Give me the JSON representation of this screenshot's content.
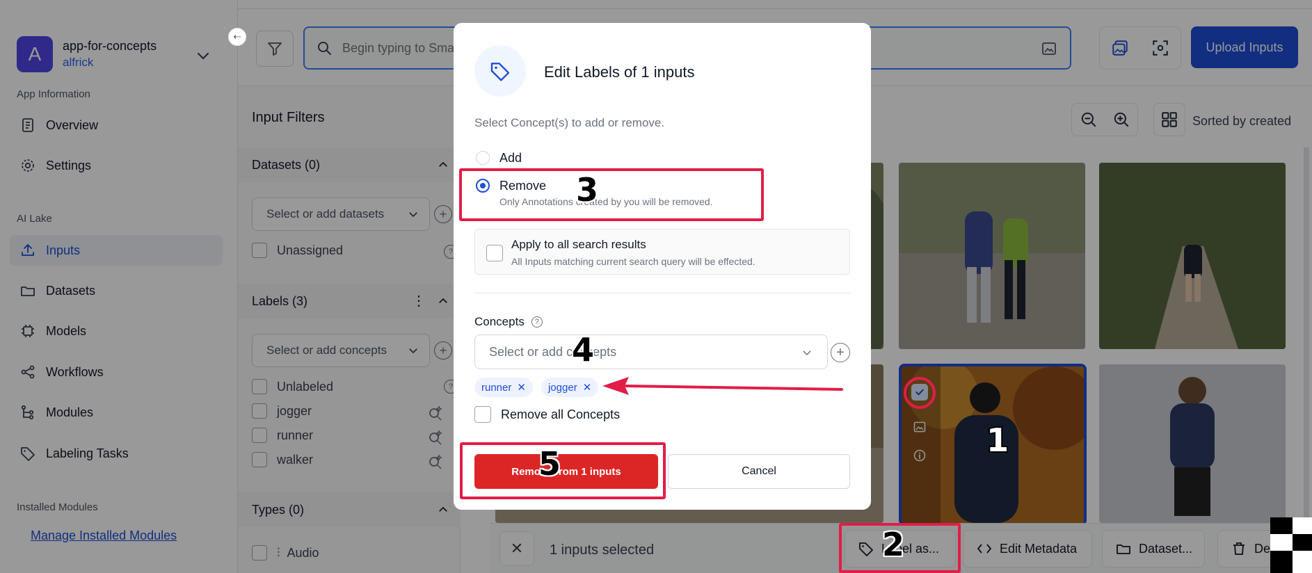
{
  "app": {
    "avatar_letter": "A",
    "name": "app-for-concepts",
    "user": "alfrick",
    "brand_color": "#4f46e5",
    "accent_color": "#1d4ed8",
    "danger_color": "#dc2626",
    "annotation_color": "#e11d48"
  },
  "sidebar": {
    "section_app_info": "App Information",
    "overview": "Overview",
    "settings": "Settings",
    "section_ai_lake": "AI Lake",
    "inputs": "Inputs",
    "datasets": "Datasets",
    "models": "Models",
    "workflows": "Workflows",
    "modules": "Modules",
    "labeling_tasks": "Labeling Tasks",
    "section_installed": "Installed Modules",
    "manage_modules": "Manage Installed Modules"
  },
  "search": {
    "placeholder": "Begin typing to Smart Search"
  },
  "toolbar": {
    "upload": "Upload Inputs",
    "sorted": "Sorted by created"
  },
  "filters": {
    "title": "Input Filters",
    "datasets_header": "Datasets (0)",
    "datasets_select": "Select or add datasets",
    "unassigned": "Unassigned",
    "labels_header": "Labels (3)",
    "concepts_select": "Select or add concepts",
    "unlabeled": "Unlabeled",
    "labels": [
      "jogger",
      "runner",
      "walker"
    ],
    "types_header": "Types (0)",
    "audio": "Audio"
  },
  "action_bar": {
    "count": "1 inputs selected",
    "label_as": "Label as...",
    "edit_metadata": "Edit Metadata",
    "dataset": "Dataset...",
    "delete": "Delete"
  },
  "modal": {
    "title": "Edit Labels of 1 inputs",
    "subtitle": "Select Concept(s) to add or remove.",
    "add": "Add",
    "remove": "Remove",
    "remove_hint": "Only Annotations created by you will be removed.",
    "apply_title": "Apply to all search results",
    "apply_hint": "All Inputs matching current search query will be effected.",
    "concepts_label": "Concepts",
    "concepts_placeholder": "Select or add concepts",
    "chips": [
      "runner",
      "jogger"
    ],
    "remove_all": "Remove all Concepts",
    "primary": "Remove from 1 inputs",
    "cancel": "Cancel"
  },
  "annotations": {
    "n1": "1",
    "n2": "2",
    "n3": "3",
    "n4": "4",
    "n5": "5"
  }
}
